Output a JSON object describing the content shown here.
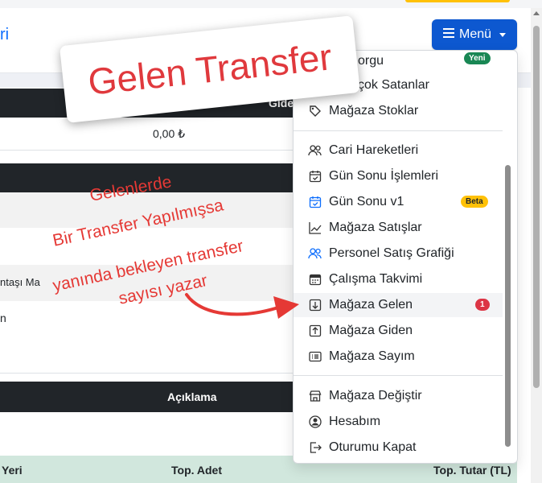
{
  "header": {
    "title_fragment": "ri",
    "menu_label": "Menü",
    "menu_icon": "hamburger-icon"
  },
  "background": {
    "row1_header_partial": "Gide",
    "row2_value": "0,00 ₺",
    "column_partial": "ntaşı Ma",
    "row_char": "n",
    "aciklama_header": "Açıklama",
    "footer": {
      "col1": "Yeri",
      "col2": "Top. Adet",
      "col3": "Top. Tutar (TL)"
    }
  },
  "menu": {
    "items": [
      {
        "label": "orgu",
        "icon": "search-icon",
        "badge": "Yeni"
      },
      {
        "label": "çok Satanlar",
        "icon": "star-icon"
      },
      {
        "label": "Mağaza Stoklar",
        "icon": "tag-icon"
      },
      {
        "label": "Cari Hareketleri",
        "icon": "people-icon"
      },
      {
        "label": "Gün Sonu İşlemleri",
        "icon": "calendar-check-icon"
      },
      {
        "label": "Gün Sonu v1",
        "icon": "calendar-check-blue-icon",
        "badge": "Beta"
      },
      {
        "label": "Mağaza Satışlar",
        "icon": "chart-line-icon"
      },
      {
        "label": "Personel Satış Grafiği",
        "icon": "people-blue-icon"
      },
      {
        "label": "Çalışma Takvimi",
        "icon": "calendar-icon"
      },
      {
        "label": "Mağaza Gelen",
        "icon": "arrow-down-square-icon",
        "badge": "1"
      },
      {
        "label": "Mağaza Giden",
        "icon": "arrow-up-square-icon"
      },
      {
        "label": "Mağaza Sayım",
        "icon": "list-card-icon"
      },
      {
        "label": "Mağaza Değiştir",
        "icon": "shop-icon"
      },
      {
        "label": "Hesabım",
        "icon": "person-circle-icon"
      },
      {
        "label": "Oturumu Kapat",
        "icon": "logout-icon"
      }
    ]
  },
  "annotation": {
    "title": "Gelen Transfer",
    "lines": [
      "Gelenlerde",
      "Bir Transfer Yapılmışsa",
      "yanında bekleyen transfer",
      "sayısı yazar"
    ]
  },
  "colors": {
    "accent": "#0d58d0",
    "annotation": "#e53935",
    "badge_red": "#dc3545",
    "badge_green": "#198754",
    "badge_yellow": "#ffc107"
  }
}
